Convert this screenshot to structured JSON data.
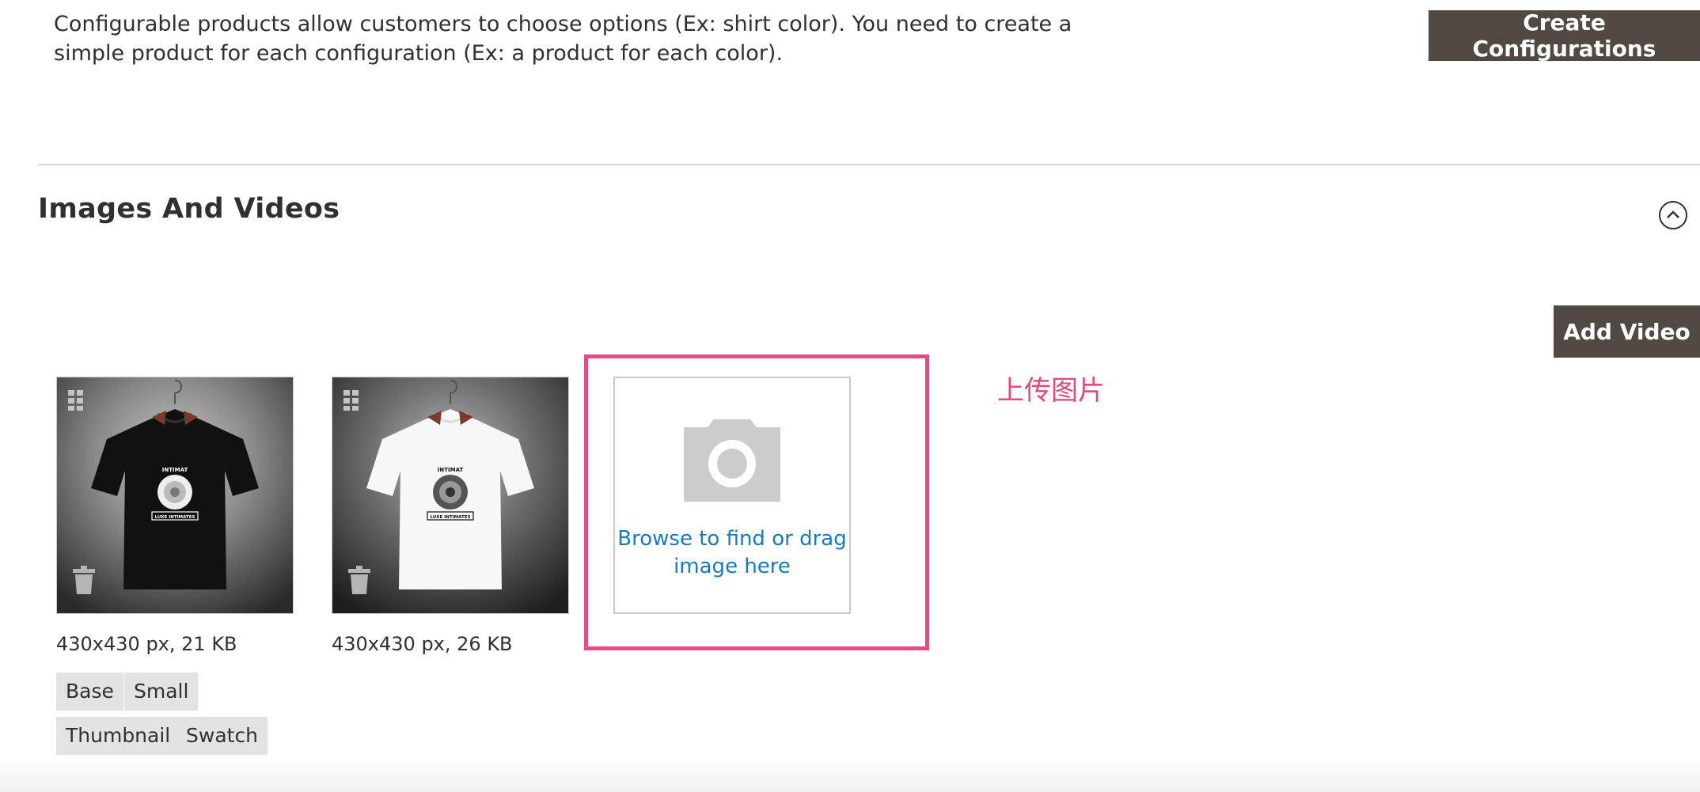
{
  "configurations": {
    "description": "Configurable products allow customers to choose options (Ex: shirt color). You need to create a simple product for each configuration (Ex: a product for each color).",
    "create_button": "Create Configurations"
  },
  "images_section": {
    "title": "Images And Videos",
    "collapse_icon": "chevron-up-circle-icon",
    "add_video_button": "Add Video",
    "images": [
      {
        "shirt": "black",
        "meta": "430x430 px, 21 KB",
        "roles": [
          "Base",
          "Small",
          "Thumbnail",
          "Swatch"
        ]
      },
      {
        "shirt": "white",
        "meta": "430x430 px, 26 KB",
        "roles": []
      }
    ],
    "uploader": {
      "icon": "camera-icon",
      "text": "Browse to find or drag image here"
    },
    "annotation": "上传图片"
  },
  "colors": {
    "button_bg": "#514943",
    "link": "#1979c3",
    "highlight": "#ea4a83"
  }
}
